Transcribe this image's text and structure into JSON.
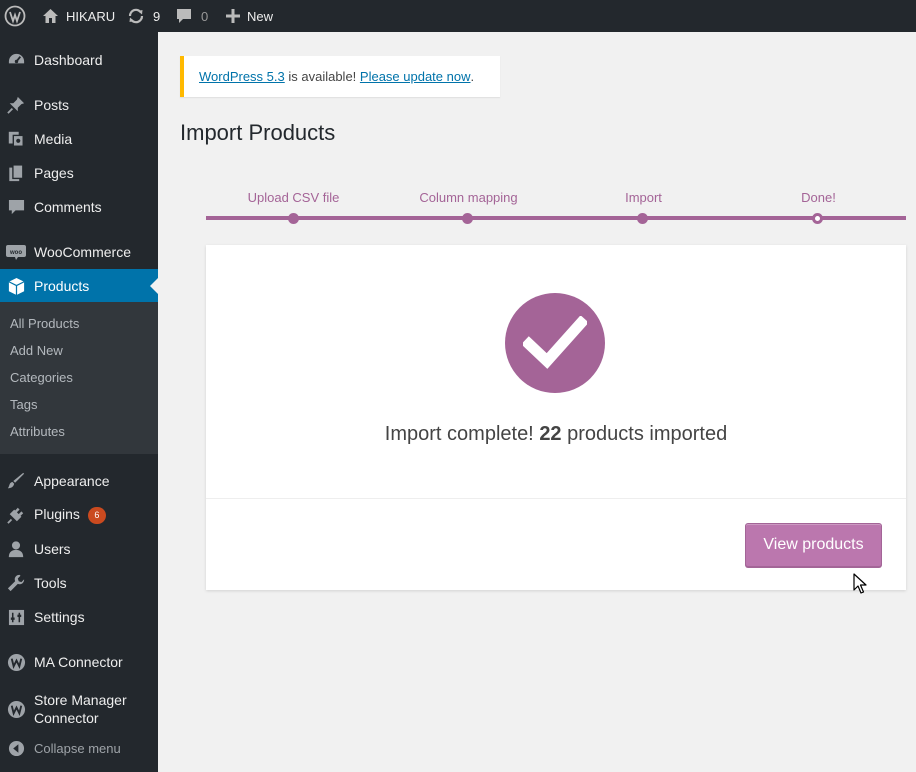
{
  "adminbar": {
    "site_name": "HIKARU",
    "updates_count": "9",
    "comments_count": "0",
    "new_label": "New"
  },
  "sidebar": {
    "items": [
      {
        "label": "Dashboard",
        "icon": "dashboard-icon"
      },
      {
        "label": "Posts",
        "icon": "pin-icon"
      },
      {
        "label": "Media",
        "icon": "media-icon"
      },
      {
        "label": "Pages",
        "icon": "pages-icon"
      },
      {
        "label": "Comments",
        "icon": "comment-icon"
      },
      {
        "label": "WooCommerce",
        "icon": "woo-icon"
      },
      {
        "label": "Products",
        "icon": "box-icon"
      },
      {
        "label": "Appearance",
        "icon": "brush-icon"
      },
      {
        "label": "Plugins",
        "icon": "plug-icon",
        "badge": "6"
      },
      {
        "label": "Users",
        "icon": "user-icon"
      },
      {
        "label": "Tools",
        "icon": "wrench-icon"
      },
      {
        "label": "Settings",
        "icon": "settings-icon"
      },
      {
        "label": "MA Connector",
        "icon": "connector-icon"
      },
      {
        "label": "Store Manager Connector",
        "icon": "connector-icon"
      },
      {
        "label": "Collapse menu",
        "icon": "collapse-icon"
      }
    ],
    "products_submenu": [
      "All Products",
      "Add New",
      "Categories",
      "Tags",
      "Attributes"
    ]
  },
  "notice": {
    "link_version": "WordPress 5.3",
    "text": " is available! ",
    "link_update": "Please update now",
    "end": "."
  },
  "page_title": "Import Products",
  "steps": [
    "Upload CSV file",
    "Column mapping",
    "Import",
    "Done!"
  ],
  "result": {
    "prefix": "Import complete! ",
    "count": "22",
    "suffix": " products imported"
  },
  "view_button": "View products",
  "colors": {
    "accent": "#a46497",
    "button": "#bb77ae",
    "admin_blue": "#0073aa",
    "sidebar_bg": "#23282d",
    "notice_border": "#ffb900"
  }
}
